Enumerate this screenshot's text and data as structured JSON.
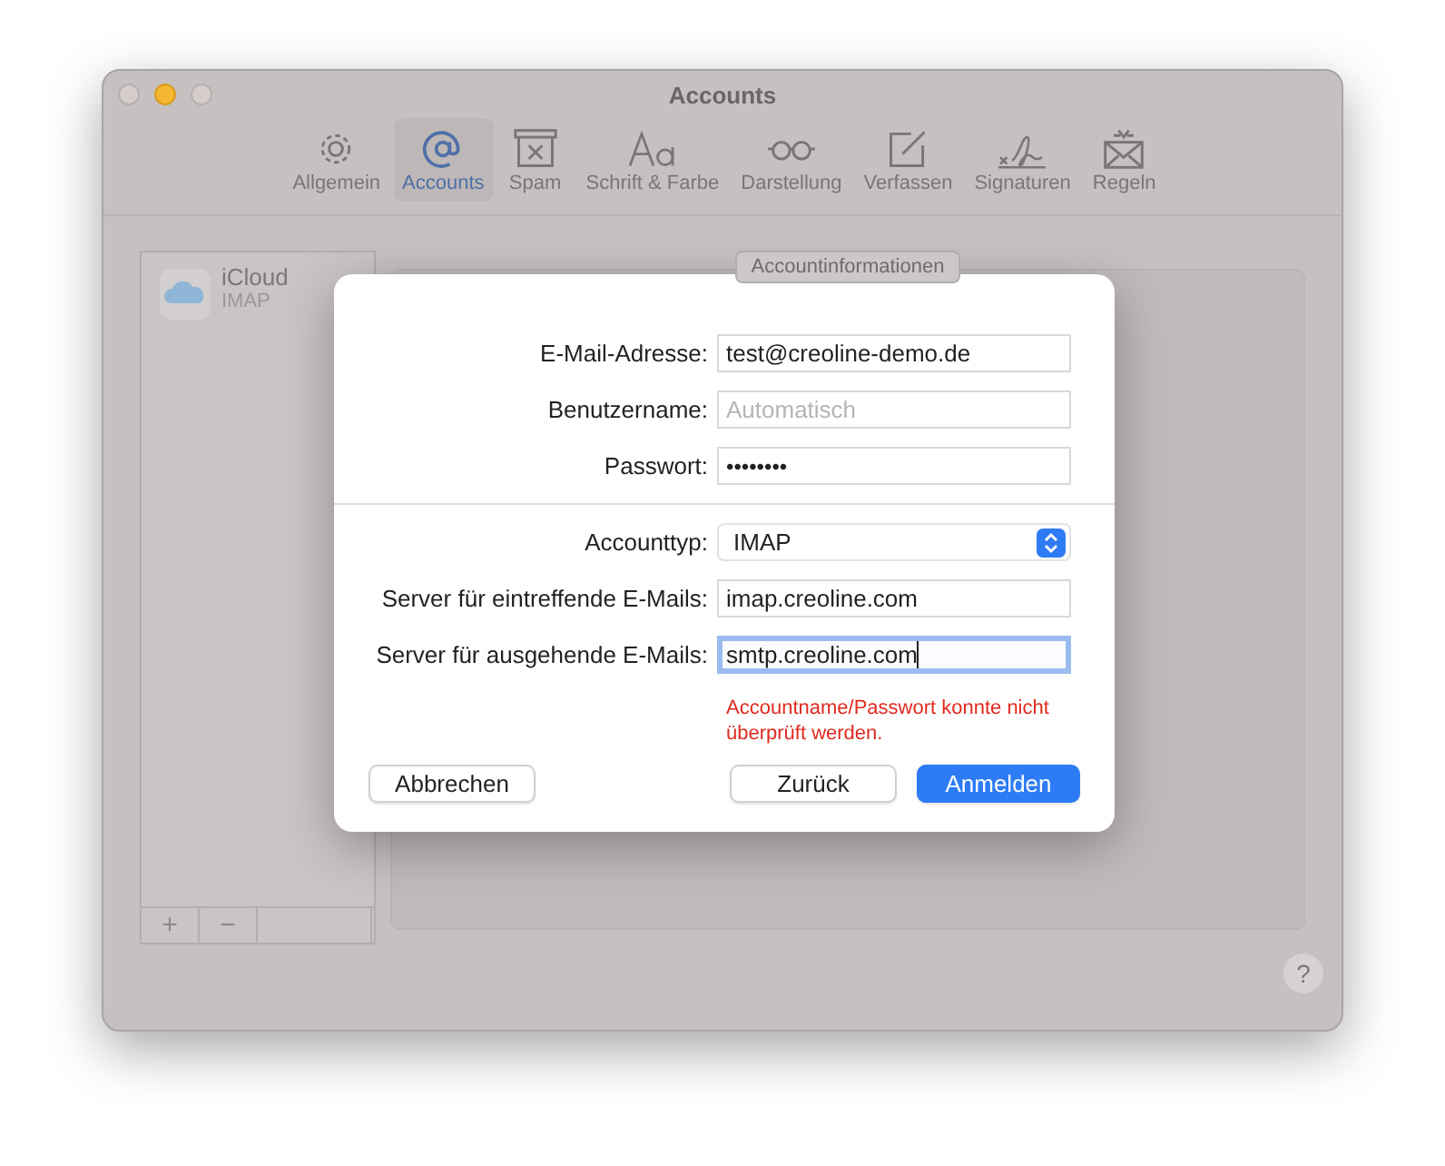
{
  "window": {
    "title": "Accounts"
  },
  "toolbar": [
    {
      "label": "Allgemein",
      "selected": false
    },
    {
      "label": "Accounts",
      "selected": true
    },
    {
      "label": "Spam",
      "selected": false
    },
    {
      "label": "Schrift & Farbe",
      "selected": false
    },
    {
      "label": "Darstellung",
      "selected": false
    },
    {
      "label": "Verfassen",
      "selected": false
    },
    {
      "label": "Signaturen",
      "selected": false
    },
    {
      "label": "Regeln",
      "selected": false
    }
  ],
  "sidebar": {
    "accounts": [
      {
        "name": "iCloud",
        "type": "IMAP"
      }
    ],
    "buttons": [
      "+",
      "−"
    ]
  },
  "tab": "Accountinformationen",
  "help": "?",
  "dialog": {
    "groups": [
      [
        {
          "label": "E-Mail-Adresse:",
          "kind": "text",
          "value": "test@creoline-demo.de",
          "focused": false
        },
        {
          "label": "Benutzername:",
          "kind": "text",
          "placeholder": "Automatisch",
          "focused": false
        },
        {
          "label": "Passwort:",
          "kind": "password",
          "value": "••••••••",
          "focused": false
        }
      ],
      [
        {
          "label": "Accounttyp:",
          "kind": "select",
          "value": "IMAP",
          "focused": false
        },
        {
          "label": "Server für eintreffende E-Mails:",
          "kind": "text",
          "value": "imap.creoline.com",
          "focused": false
        },
        {
          "label": "Server für ausgehende E-Mails:",
          "kind": "text",
          "value": "smtp.creoline.com",
          "focused": true
        }
      ]
    ],
    "error": "Accountname/Passwort konnte nicht überprüft werden.",
    "buttons": [
      {
        "label": "Abbrechen",
        "kind": "cancel"
      },
      {
        "label": "Zurück",
        "kind": "normal"
      },
      {
        "label": "Anmelden",
        "kind": "default"
      }
    ]
  }
}
